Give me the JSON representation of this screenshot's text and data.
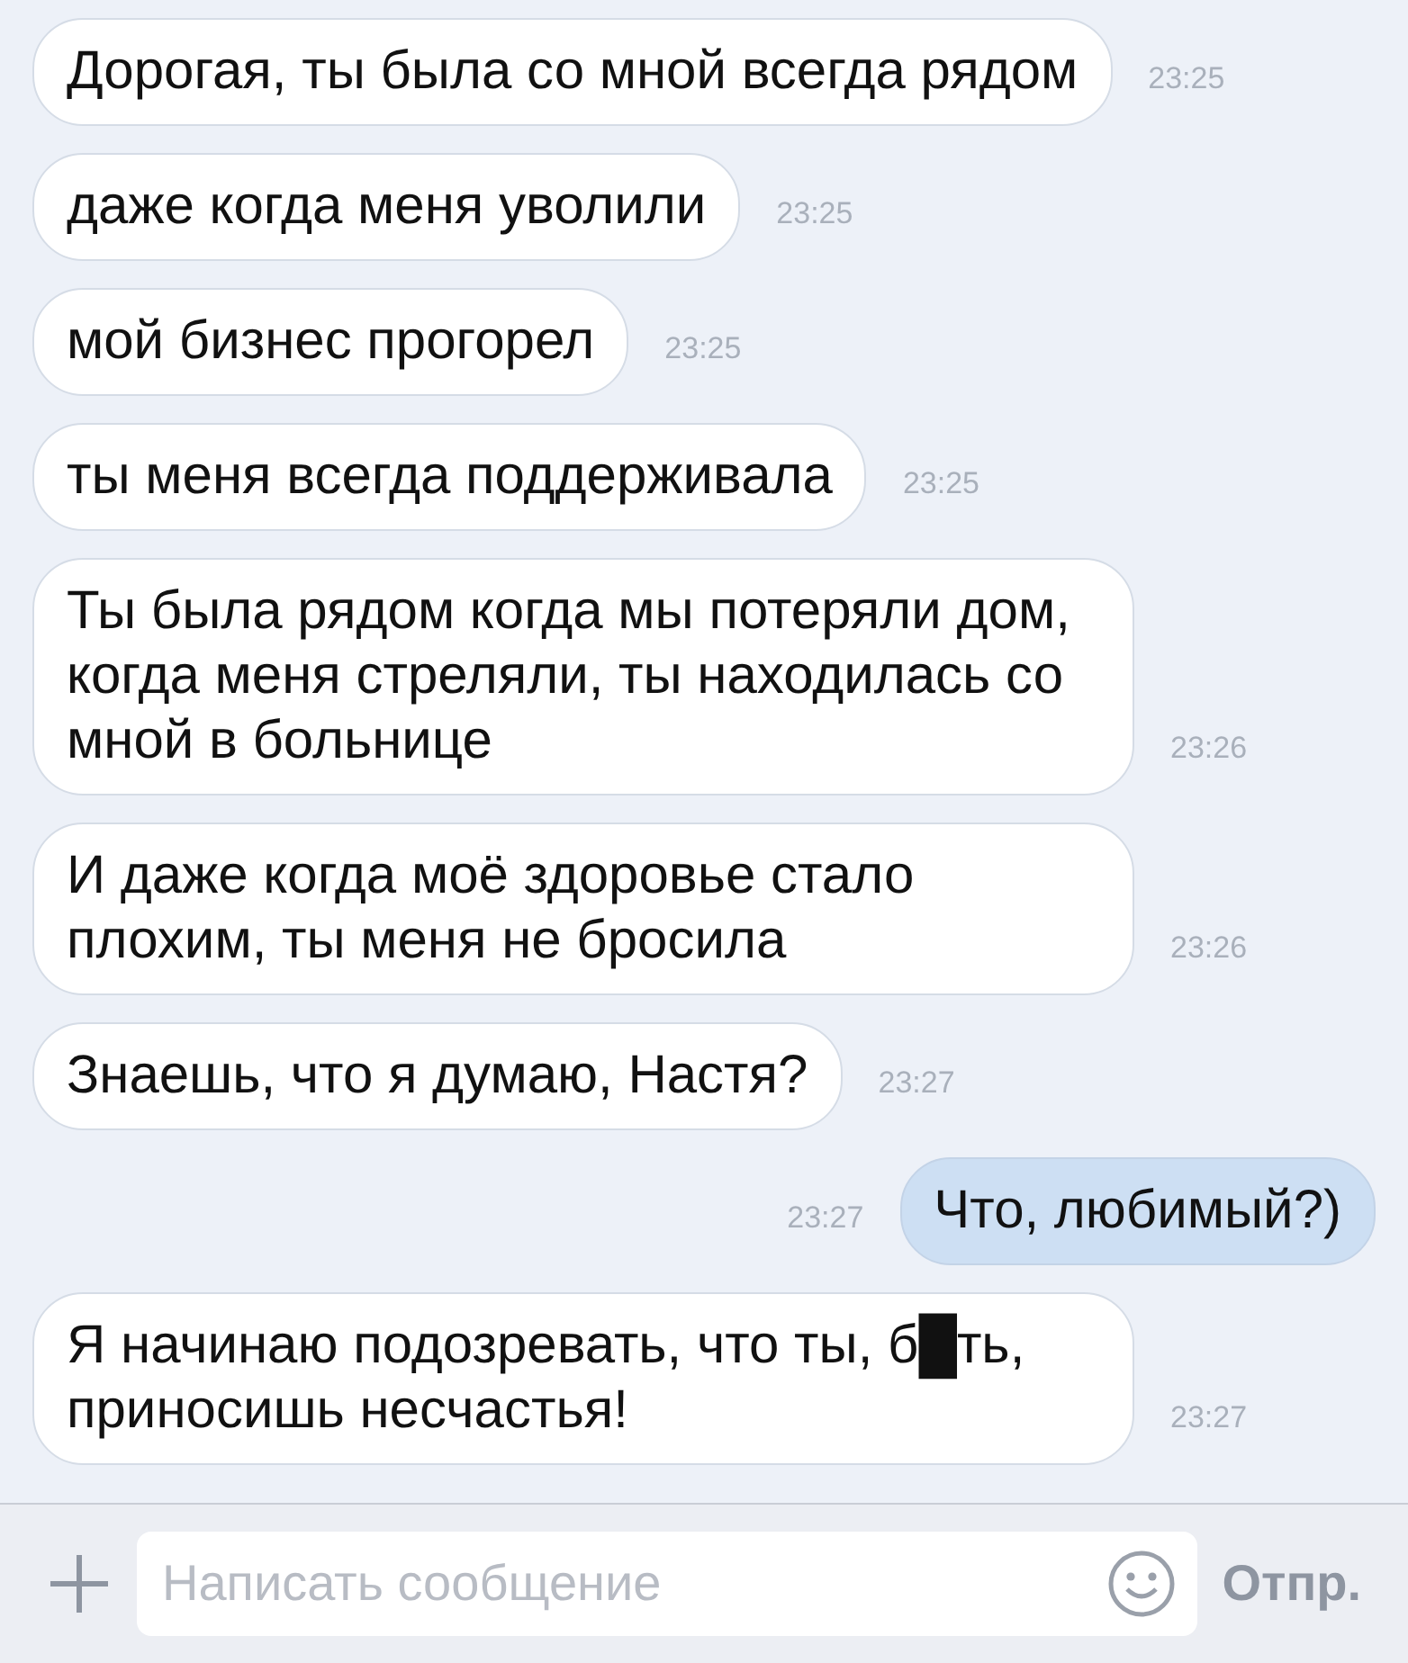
{
  "messages": [
    {
      "kind": "incoming",
      "text": "Дорогая, ты была со мной всегда рядом",
      "time": "23:25"
    },
    {
      "kind": "incoming",
      "text": "даже когда меня уволили",
      "time": "23:25"
    },
    {
      "kind": "incoming",
      "text": "мой бизнес прогорел",
      "time": "23:25"
    },
    {
      "kind": "incoming",
      "text": "ты меня всегда поддерживала",
      "time": "23:25"
    },
    {
      "kind": "incoming",
      "text": "Ты была рядом когда мы потеряли дом, когда меня стреляли, ты находилась со мной в больнице",
      "time": "23:26"
    },
    {
      "kind": "incoming",
      "text": "И даже когда моё здоровье стало плохим, ты меня не бросила",
      "time": "23:26"
    },
    {
      "kind": "incoming",
      "text": "Знаешь, что я думаю, Настя?",
      "time": "23:27"
    },
    {
      "kind": "outgoing",
      "text": "Что, любимый?)",
      "time": "23:27"
    },
    {
      "kind": "incoming",
      "text": "Я начинаю подозревать, что ты, б█ть, приносишь несчастья!",
      "time": "23:27"
    }
  ],
  "composer": {
    "placeholder": "Написать сообщение",
    "send": "Отпр."
  }
}
